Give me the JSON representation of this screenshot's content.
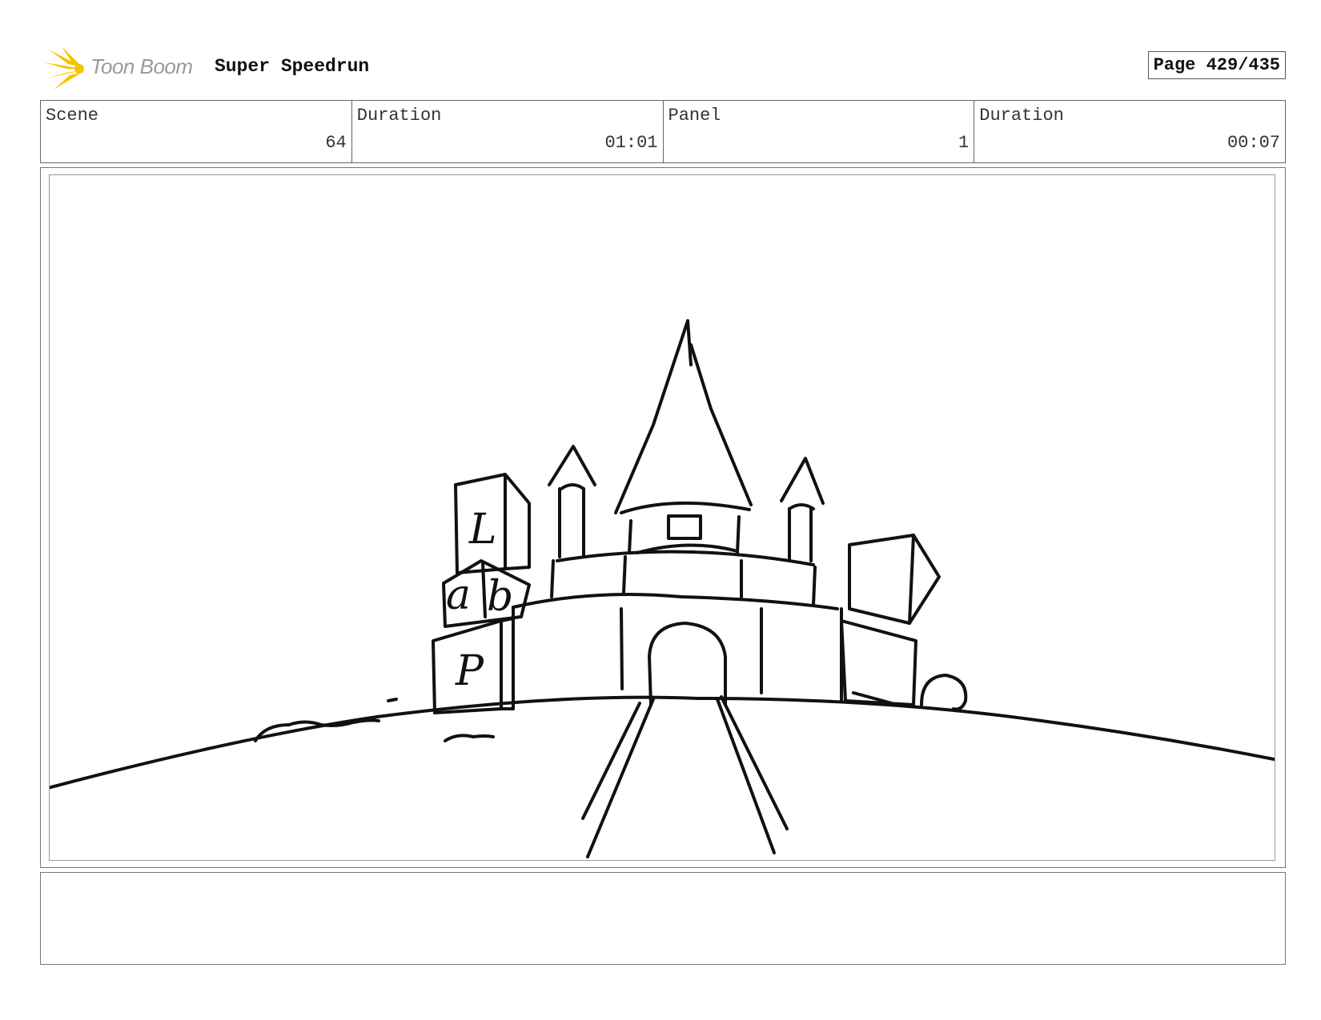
{
  "header": {
    "logo": {
      "brand": "Toon Boom",
      "icon": "toon-boom-star-icon"
    },
    "project_title": "Super Speedrun",
    "page_label": "Page 429/435"
  },
  "info": {
    "scene_label": "Scene",
    "scene_value": "64",
    "scene_duration_label": "Duration",
    "scene_duration_value": "01:01",
    "panel_label": "Panel",
    "panel_value": "1",
    "panel_duration_label": "Duration",
    "panel_duration_value": "00:07"
  },
  "panel": {
    "sketch_letters": [
      "L",
      "a",
      "b",
      "P"
    ]
  },
  "notes": {
    "text": ""
  },
  "colors": {
    "logo_yellow": "#f5c400",
    "logo_grey": "#9a9a9a",
    "border": "#777777",
    "ink": "#111111"
  }
}
